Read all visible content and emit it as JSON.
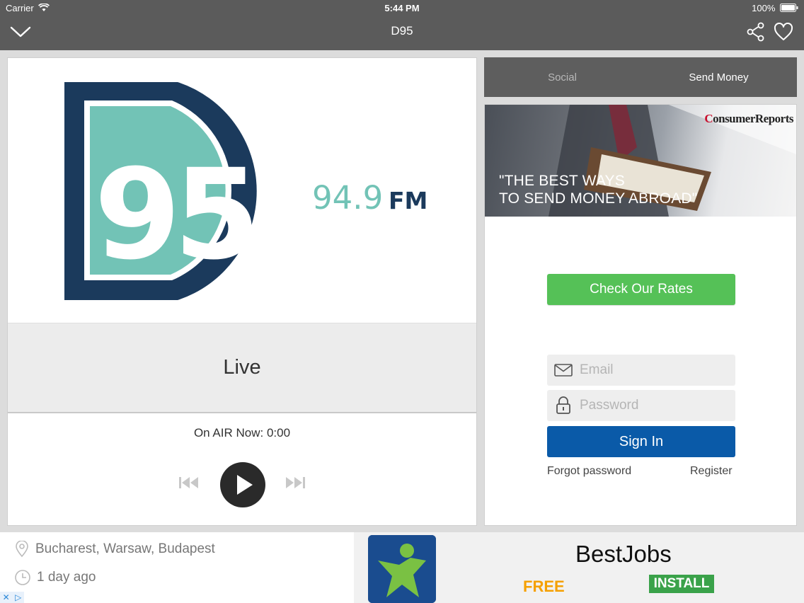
{
  "status_bar": {
    "carrier": "Carrier",
    "time": "5:44 PM",
    "battery": "100%"
  },
  "nav": {
    "title": "D95",
    "left_icon": "chevron-down-icon",
    "right_icons": [
      "share-icon",
      "heart-icon"
    ]
  },
  "station": {
    "logo_numerals": "95",
    "frequency": "94.9",
    "band": "FM",
    "colors": {
      "navy": "#1b3a5c",
      "teal": "#72c3b6"
    }
  },
  "live": {
    "label": "Live"
  },
  "player": {
    "on_air_label": "On AIR Now:",
    "elapsed": "0:00"
  },
  "tabs": [
    {
      "label": "Social",
      "active": false
    },
    {
      "label": "Send Money",
      "active": true
    }
  ],
  "send_money": {
    "banner_brand": {
      "first_letter": "C",
      "rest": "onsumerReports"
    },
    "banner_quote_line1": "\"THE BEST WAYS",
    "banner_quote_line2": "TO SEND MONEY ABROAD\"",
    "check_rates_label": "Check Our Rates",
    "email_placeholder": "Email",
    "password_placeholder": "Password",
    "sign_in_label": "Sign In",
    "forgot_password_label": "Forgot password",
    "register_label": "Register",
    "colors": {
      "green": "#55c157",
      "blue": "#0a5aa8"
    }
  },
  "ad": {
    "location": "Bucharest, Warsaw, Budapest",
    "posted": "1 day ago",
    "app_name": "BestJobs",
    "free_label": "FREE",
    "install_label": "INSTALL",
    "colors": {
      "free": "#f5a000",
      "install": "#3aa24a"
    }
  }
}
